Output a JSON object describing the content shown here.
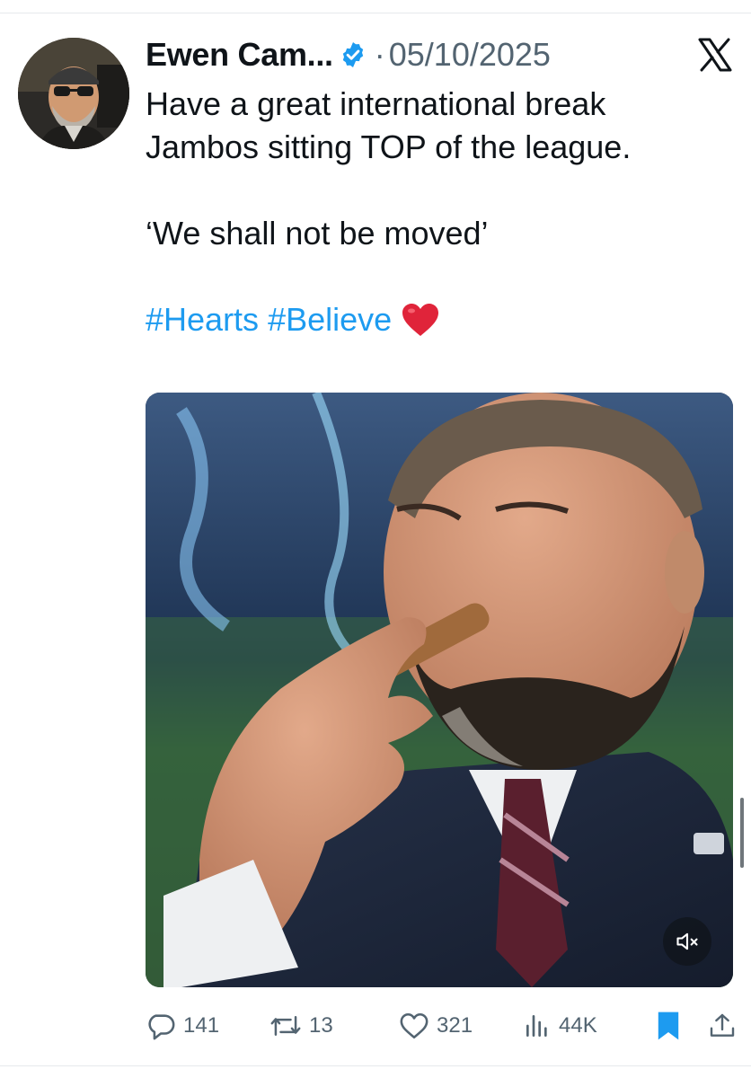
{
  "post": {
    "author": {
      "display_name": "Ewen Cam...",
      "verified_icon": "verified-badge-icon",
      "avatar": "avatar"
    },
    "separator": "·",
    "date": "05/10/2025",
    "platform_icon": "x-logo-icon",
    "text": {
      "line1": "Have a great international break",
      "line2": "Jambos sitting TOP of the league.",
      "quote": "‘We shall not be moved’",
      "hashtags": [
        "#Hearts",
        "#Believe"
      ],
      "emoji_icon": "red-heart-icon"
    },
    "media": {
      "type": "video",
      "mute_icon": "speaker-muted-icon"
    },
    "metrics": {
      "replies": "141",
      "reposts": "13",
      "likes": "321",
      "views": "44K"
    },
    "actions": {
      "reply_icon": "reply-icon",
      "repost_icon": "repost-icon",
      "like_icon": "heart-icon",
      "views_icon": "views-chart-icon",
      "bookmark_icon": "bookmark-icon",
      "share_icon": "share-icon"
    }
  },
  "colors": {
    "text": "#0f1419",
    "secondary": "#536471",
    "accent": "#1d9bf0",
    "heart": "#e0243a"
  }
}
